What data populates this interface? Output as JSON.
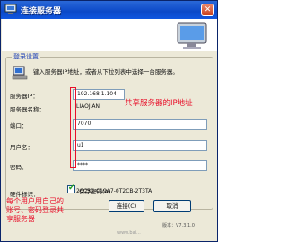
{
  "window": {
    "title": "连接服务器",
    "close_glyph": "✕"
  },
  "header_icon": "computer-monitor-icon",
  "group": {
    "title": "登录设置",
    "info_text": "键入服务器IP地址，或者从下拉列表中选择一台服务器。"
  },
  "form": {
    "ip_label": "服务器IP：",
    "ip_value": "192.168.1.104",
    "name_label": "服务器名称：",
    "name_value": "LIAOJIAN",
    "port_label": "端口：",
    "port_value": "7070",
    "user_label": "用户名：",
    "user_value": "u1",
    "password_label": "密码：",
    "password_value": "****",
    "save_password_label": "保存密码(A)",
    "hw_label": "硬件标识：",
    "hw_value": "2CC30-C19A7-0T2CB-2T3TA"
  },
  "buttons": {
    "connect": "连接(C)",
    "cancel": "取消"
  },
  "annotations": {
    "shared_server_ip": "共享服务器的IP地址",
    "user_note_line1": "每个用户用自己的",
    "user_note_line2": "账号、密码登录共",
    "user_note_line3": "享服务器"
  },
  "version": "版本：V7.3.1.0",
  "watermark": "www.bai..."
}
